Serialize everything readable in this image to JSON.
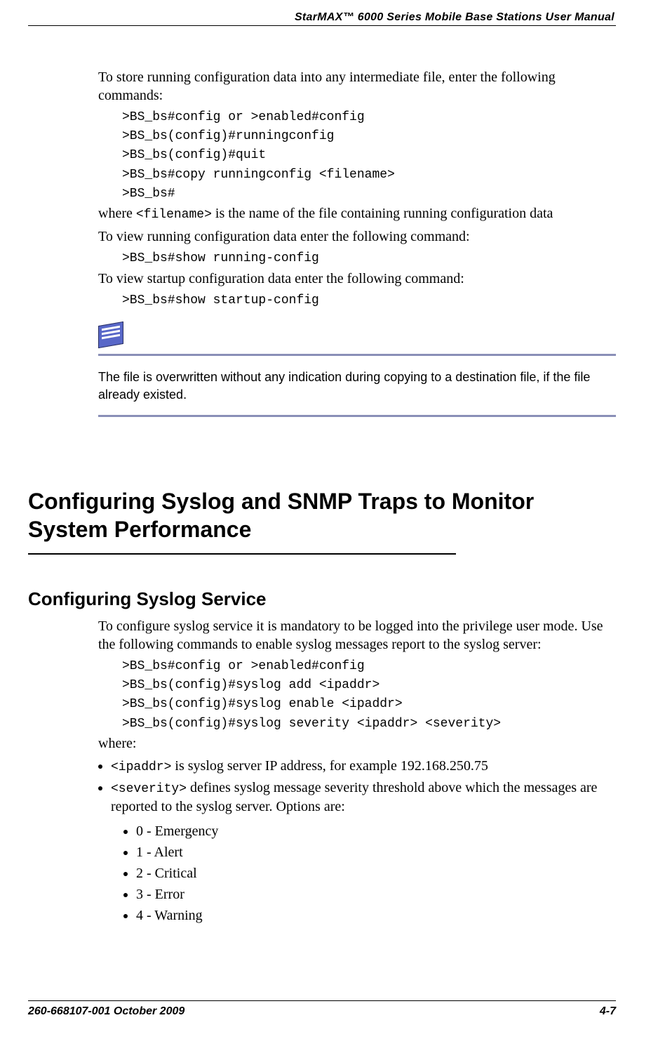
{
  "header": {
    "title": "StarMAX™ 6000 Series Mobile Base Stations User Manual"
  },
  "footer": {
    "left": "260-668107-001 October 2009",
    "page": "4-7"
  },
  "intro": {
    "p1": "To store running configuration data into any intermediate file, enter the following commands:",
    "cmds1": [
      ">BS_bs#config or >enabled#config",
      ">BS_bs(config)#runningconfig",
      ">BS_bs(config)#quit",
      ">BS_bs#copy runningconfig <filename>",
      ">BS_bs#"
    ],
    "where_prefix": "where ",
    "where_code": "<filename>",
    "where_suffix": " is the name of the file containing running configuration data",
    "p2": "To view running configuration data enter the following command:",
    "cmd2": ">BS_bs#show running-config",
    "p3": "To view startup configuration data enter the following command:",
    "cmd3": ">BS_bs#show startup-config"
  },
  "note": {
    "text": "The file is overwritten without any indication during copying to a destination file, if the file already existed."
  },
  "section": {
    "heading": "Configuring Syslog and SNMP Traps to Monitor System Performance",
    "sub": "Configuring Syslog Service",
    "p1": "To configure syslog service it is mandatory to be logged into the privilege user mode. Use the following commands to enable syslog messages report to the syslog server:",
    "cmds": [
      ">BS_bs#config or >enabled#config",
      ">BS_bs(config)#syslog add <ipaddr>",
      ">BS_bs(config)#syslog enable <ipaddr>",
      ">BS_bs(config)#syslog severity <ipaddr> <severity>"
    ],
    "where": "where:",
    "bullets": {
      "b1_code": "<ipaddr>",
      "b1_text": " is syslog server IP address, for example 192.168.250.75",
      "b2_code": "<severity>",
      "b2_text": " defines syslog message severity threshold above which the messages are reported to the syslog server. Options are:"
    },
    "severity": [
      "0 - Emergency",
      "1 - Alert",
      "2 - Critical",
      "3 - Error",
      "4 - Warning"
    ]
  }
}
